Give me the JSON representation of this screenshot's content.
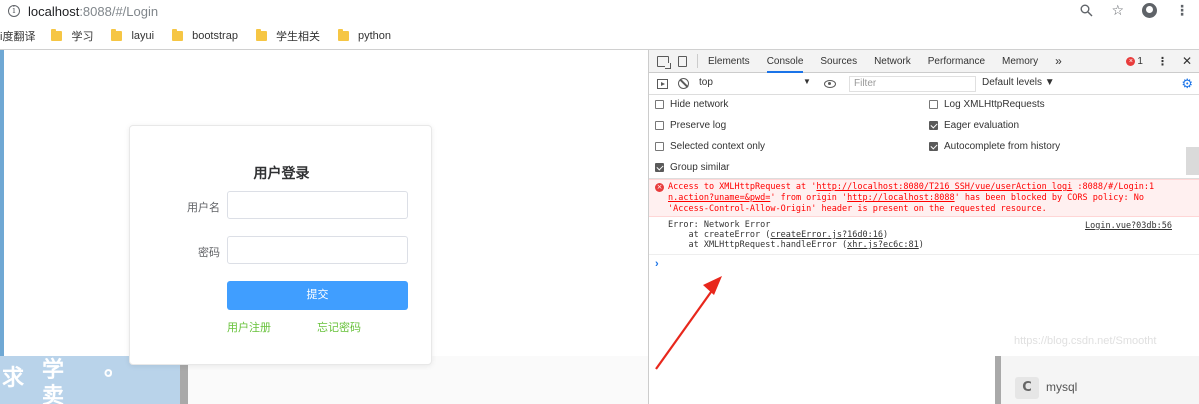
{
  "browser": {
    "url_host": "localhost",
    "url_path": ":8088/#/Login",
    "icons": [
      "info-icon",
      "zoom-icon",
      "star-icon",
      "profile-icon",
      "menu-icon"
    ]
  },
  "bookmarks": [
    {
      "label": "i度翻译",
      "icon": "folder-icon"
    },
    {
      "label": "学习",
      "icon": "folder-icon"
    },
    {
      "label": "layui",
      "icon": "folder-icon"
    },
    {
      "label": "bootstrap",
      "icon": "folder-icon"
    },
    {
      "label": "学生相关",
      "icon": "folder-icon"
    },
    {
      "label": "python",
      "icon": "folder-icon"
    }
  ],
  "login": {
    "title": "用户登录",
    "username_label": "用户名",
    "password_label": "密码",
    "submit_label": "提交",
    "register_link": "用户注册",
    "forgot_link": "忘记密码"
  },
  "background": {
    "chars": [
      "求",
      "学",
      "卖",
      "。"
    ]
  },
  "devtools": {
    "tabs": [
      "Elements",
      "Console",
      "Sources",
      "Network",
      "Performance",
      "Memory"
    ],
    "more_tabs": "»",
    "active_tab": "Console",
    "error_count": "1",
    "context": "top",
    "filter_placeholder": "Filter",
    "levels": "Default levels ▼",
    "settings": [
      {
        "label": "Hide network",
        "checked": false
      },
      {
        "label": "Log XMLHttpRequests",
        "checked": false
      },
      {
        "label": "Preserve log",
        "checked": false
      },
      {
        "label": "Eager evaluation",
        "checked": true
      },
      {
        "label": "Selected context only",
        "checked": false
      },
      {
        "label": "Autocomplete from history",
        "checked": true
      },
      {
        "label": "Group similar",
        "checked": true
      }
    ],
    "error": {
      "line1_a": "Access to XMLHttpRequest at '",
      "line1_link": "http://localhost:8080/T216_SSH/vue/userAction_logi",
      "line1_b": " :8088/#/Login:1",
      "line2_a": "n.action?uname=&pwd=",
      "line2_b": "' from origin '",
      "line2_link": "http://localhost:8088",
      "line2_c": "' has been blocked by CORS policy: No",
      "line3": "'Access-Control-Allow-Origin' header is present on the requested resource."
    },
    "log": {
      "line1": "Error: Network Error",
      "line2_a": "    at createError (",
      "line2_link": "createError.js?16d0:16",
      "line2_b": ")",
      "line3_a": "    at XMLHttpRequest.handleError (",
      "line3_link": "xhr.js?ec6c:81",
      "line3_b": ")",
      "source": "Login.vue?03db:56"
    },
    "prompt": "›"
  },
  "overlay": {
    "watermark": "https://blog.csdn.net/Smootht",
    "item_label": "mysql"
  }
}
